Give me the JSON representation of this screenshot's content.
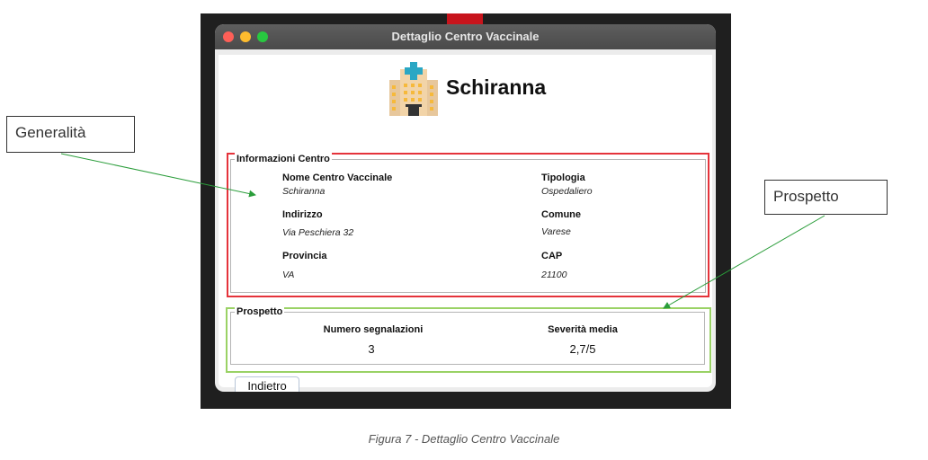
{
  "window": {
    "title": "Dettaglio Centro Vaccinale"
  },
  "header": {
    "icon": "hospital-icon",
    "center_name": "Schiranna"
  },
  "informazioni": {
    "group_label": "Informazioni Centro",
    "fields": [
      {
        "label": "Nome Centro Vaccinale",
        "value": "Schiranna"
      },
      {
        "label": "Tipologia",
        "value": "Ospedaliero"
      },
      {
        "label": "Indirizzo",
        "value": "Via Peschiera 32"
      },
      {
        "label": "Comune",
        "value": "Varese"
      },
      {
        "label": "Provincia",
        "value": "VA"
      },
      {
        "label": "CAP",
        "value": "21100"
      }
    ]
  },
  "prospetto": {
    "group_label": "Prospetto",
    "segnalazioni_label": "Numero segnalazioni",
    "segnalazioni_value": "3",
    "severita_label": "Severità media",
    "severita_value": "2,7/5"
  },
  "buttons": {
    "back_label": "Indietro"
  },
  "annotations": {
    "generalita": "Generalità",
    "prospetto": "Prospetto"
  },
  "caption": "Figura 7 - Dettaglio Centro Vaccinale",
  "colors": {
    "highlight_generalita": "#e5333b",
    "highlight_prospetto": "#9ad265",
    "arrow": "#2a9d3a"
  }
}
